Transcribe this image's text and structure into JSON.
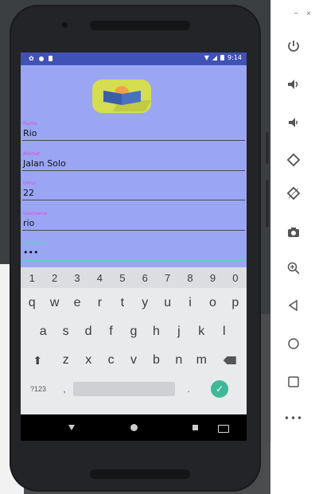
{
  "status_bar": {
    "time": "9:14"
  },
  "form": {
    "fields": [
      {
        "label": "Nama",
        "value": "Rio"
      },
      {
        "label": "Alamat",
        "value": "Jalan Solo"
      },
      {
        "label": "Umur",
        "value": "22"
      },
      {
        "label": "Username",
        "value": "rio"
      },
      {
        "label": "Password",
        "value": "•••"
      }
    ]
  },
  "keyboard": {
    "numbers": [
      "1",
      "2",
      "3",
      "4",
      "5",
      "6",
      "7",
      "8",
      "9",
      "0"
    ],
    "row1": [
      "q",
      "w",
      "e",
      "r",
      "t",
      "y",
      "u",
      "i",
      "o",
      "p"
    ],
    "row2": [
      "a",
      "s",
      "d",
      "f",
      "g",
      "h",
      "j",
      "k",
      "l"
    ],
    "row3": [
      "z",
      "x",
      "c",
      "v",
      "b",
      "n",
      "m"
    ],
    "symbols_label": "?123",
    "comma": ",",
    "period": "."
  },
  "emulator_toolbar": {
    "window_controls": [
      "−",
      "×"
    ],
    "more_label": "•••",
    "icons": [
      "power-icon",
      "volume-up-icon",
      "volume-down-icon",
      "rotate-left-icon",
      "rotate-right-icon",
      "camera-icon",
      "zoom-in-icon",
      "back-icon",
      "home-icon",
      "overview-icon",
      "more-icon"
    ]
  },
  "colors": {
    "app_background": "#9aa6f4",
    "status_bar": "#4052b5",
    "label_pink": "#e34bcf",
    "focus_teal": "#59d6b6",
    "enter_key": "#3fb898"
  }
}
